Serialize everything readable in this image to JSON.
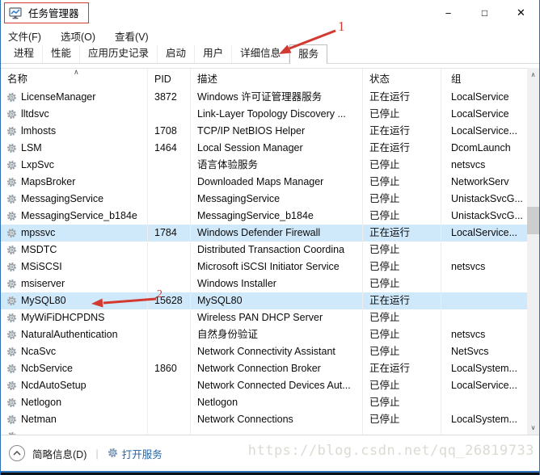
{
  "window": {
    "title": "任务管理器",
    "controls": {
      "minimize": "−",
      "maximize": "□",
      "close": "✕"
    }
  },
  "menu": {
    "items": [
      {
        "label": "文件(F)"
      },
      {
        "label": "选项(O)"
      },
      {
        "label": "查看(V)"
      }
    ]
  },
  "tabs": {
    "items": [
      {
        "label": "进程"
      },
      {
        "label": "性能"
      },
      {
        "label": "应用历史记录"
      },
      {
        "label": "启动"
      },
      {
        "label": "用户"
      },
      {
        "label": "详细信息"
      },
      {
        "label": "服务",
        "active": true
      }
    ]
  },
  "annotations": {
    "one": "1",
    "two": "2",
    "color": "#d23a31"
  },
  "table": {
    "sort_indicator": "∧",
    "columns": [
      {
        "label": "名称"
      },
      {
        "label": "PID"
      },
      {
        "label": "描述"
      },
      {
        "label": "状态"
      },
      {
        "label": "组"
      }
    ],
    "rows": [
      {
        "name": "LicenseManager",
        "pid": "3872",
        "desc": "Windows 许可证管理器服务",
        "status": "正在运行",
        "group": "LocalService"
      },
      {
        "name": "lltdsvc",
        "pid": "",
        "desc": "Link-Layer Topology Discovery ...",
        "status": "已停止",
        "group": "LocalService"
      },
      {
        "name": "lmhosts",
        "pid": "1708",
        "desc": "TCP/IP NetBIOS Helper",
        "status": "正在运行",
        "group": "LocalService..."
      },
      {
        "name": "LSM",
        "pid": "1464",
        "desc": "Local Session Manager",
        "status": "正在运行",
        "group": "DcomLaunch"
      },
      {
        "name": "LxpSvc",
        "pid": "",
        "desc": "语言体验服务",
        "status": "已停止",
        "group": "netsvcs"
      },
      {
        "name": "MapsBroker",
        "pid": "",
        "desc": "Downloaded Maps Manager",
        "status": "已停止",
        "group": "NetworkServ"
      },
      {
        "name": "MessagingService",
        "pid": "",
        "desc": "MessagingService",
        "status": "已停止",
        "group": "UnistackSvcG..."
      },
      {
        "name": "MessagingService_b184e",
        "pid": "",
        "desc": "MessagingService_b184e",
        "status": "已停止",
        "group": "UnistackSvcG..."
      },
      {
        "name": "mpssvc",
        "pid": "1784",
        "desc": "Windows Defender Firewall",
        "status": "正在运行",
        "group": "LocalService...",
        "highlight": true
      },
      {
        "name": "MSDTC",
        "pid": "",
        "desc": "Distributed Transaction Coordina",
        "status": "已停止",
        "group": ""
      },
      {
        "name": "MSiSCSI",
        "pid": "",
        "desc": "Microsoft iSCSI Initiator Service",
        "status": "已停止",
        "group": "netsvcs"
      },
      {
        "name": "msiserver",
        "pid": "",
        "desc": "Windows Installer",
        "status": "已停止",
        "group": ""
      },
      {
        "name": "MySQL80",
        "pid": "15628",
        "desc": "MySQL80",
        "status": "正在运行",
        "group": "",
        "highlight": true
      },
      {
        "name": "MyWiFiDHCPDNS",
        "pid": "",
        "desc": "Wireless PAN DHCP Server",
        "status": "已停止",
        "group": ""
      },
      {
        "name": "NaturalAuthentication",
        "pid": "",
        "desc": "自然身份验证",
        "status": "已停止",
        "group": "netsvcs"
      },
      {
        "name": "NcaSvc",
        "pid": "",
        "desc": "Network Connectivity Assistant",
        "status": "已停止",
        "group": "NetSvcs"
      },
      {
        "name": "NcbService",
        "pid": "1860",
        "desc": "Network Connection Broker",
        "status": "正在运行",
        "group": "LocalSystem..."
      },
      {
        "name": "NcdAutoSetup",
        "pid": "",
        "desc": "Network Connected Devices Aut...",
        "status": "已停止",
        "group": "LocalService..."
      },
      {
        "name": "Netlogon",
        "pid": "",
        "desc": "Netlogon",
        "status": "已停止",
        "group": ""
      },
      {
        "name": "Netman",
        "pid": "",
        "desc": "Network Connections",
        "status": "已停止",
        "group": "LocalSystem..."
      },
      {
        "name": "",
        "pid": "",
        "desc": "",
        "status": "",
        "group": "",
        "partial": true
      }
    ]
  },
  "statusbar": {
    "fewer_details": "简略信息(D)",
    "separator": "|",
    "open_services": "打开服务"
  },
  "watermark": "https://blog.csdn.net/qq_26819733",
  "colors": {
    "highlight_row": "#cfe9fb",
    "annotation": "#d23a31",
    "link": "#2464a4",
    "accent_border": "#2d6fb5"
  }
}
